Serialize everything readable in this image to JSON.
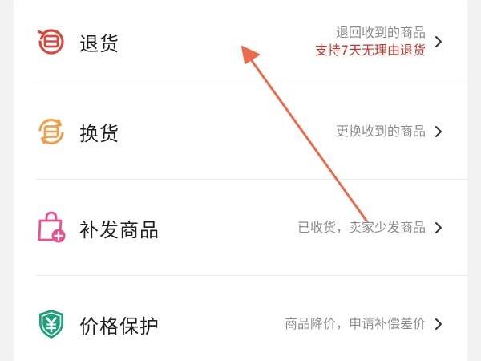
{
  "items": [
    {
      "title": "退货",
      "desc": "退回收到的商品",
      "promo": "支持7天无理由退货",
      "icon": "return-icon",
      "color": "#e0453a"
    },
    {
      "title": "换货",
      "desc": "更换收到的商品",
      "icon": "exchange-icon",
      "color": "#f0a04b"
    },
    {
      "title": "补发商品",
      "desc": "已收货，卖家少发商品",
      "icon": "reship-bag-icon",
      "color": "#e8508f"
    },
    {
      "title": "价格保护",
      "desc": "商品降价，申请补偿差价",
      "icon": "price-protect-shield-icon",
      "color": "#1aa37a"
    }
  ],
  "annotation": {
    "color": "#ec6a4c"
  }
}
